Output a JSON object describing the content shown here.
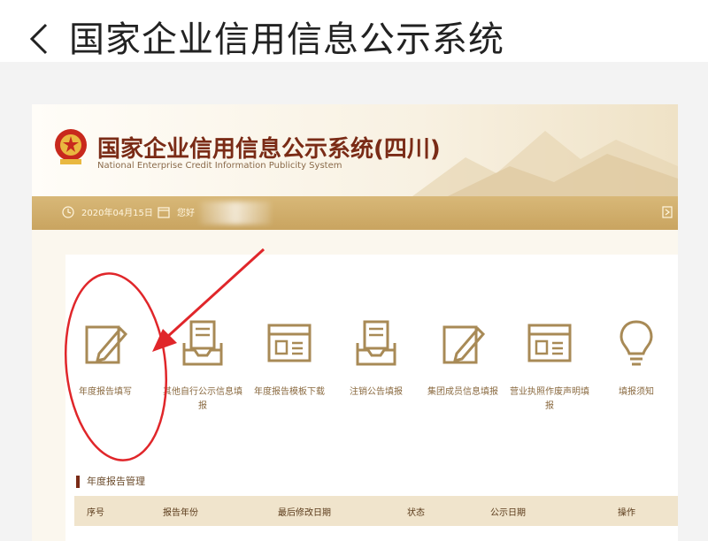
{
  "app_bar": {
    "title": "国家企业信用信息公示系统"
  },
  "site": {
    "title": "国家企业信用信息公示系统(四川)",
    "subtitle": "National Enterprise Credit Information Publicity System",
    "toolbar": {
      "date": "2020年04月15日",
      "login": "您好"
    }
  },
  "tiles": [
    {
      "label": "年度报告填写",
      "icon": "edit-form-icon"
    },
    {
      "label": "其他自行公示信息填报",
      "icon": "document-tray-icon"
    },
    {
      "label": "年度报告模板下载",
      "icon": "template-window-icon"
    },
    {
      "label": "注销公告填报",
      "icon": "document-tray-icon"
    },
    {
      "label": "集团成员信息填报",
      "icon": "edit-form-icon"
    },
    {
      "label": "营业执照作废声明填报",
      "icon": "template-window-icon"
    },
    {
      "label": "填报须知",
      "icon": "lightbulb-icon"
    }
  ],
  "section": {
    "title": "年度报告管理"
  },
  "table": {
    "columns": [
      "序号",
      "报告年份",
      "最后修改日期",
      "状态",
      "公示日期",
      "操作"
    ]
  },
  "colors": {
    "accent": "#7a2b16",
    "gold": "#c9a460",
    "icon": "#a88a56",
    "annotation": "#e0262a"
  }
}
